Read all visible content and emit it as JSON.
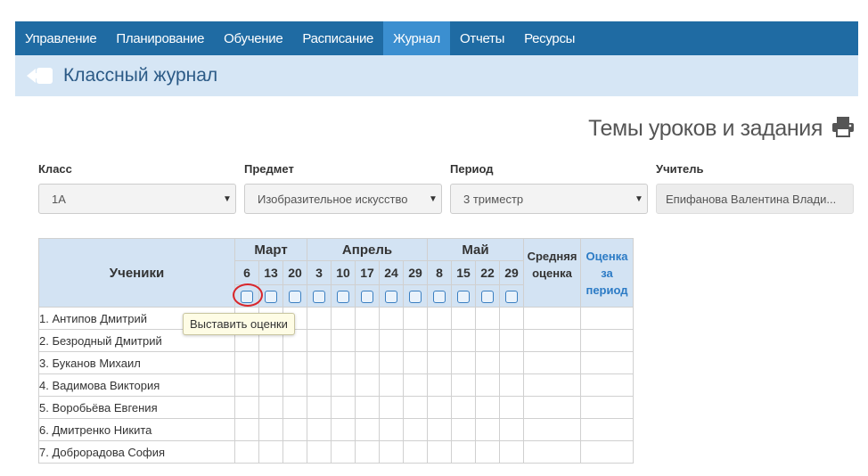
{
  "nav": {
    "items": [
      {
        "label": "Управление"
      },
      {
        "label": "Планирование"
      },
      {
        "label": "Обучение"
      },
      {
        "label": "Расписание"
      },
      {
        "label": "Журнал"
      },
      {
        "label": "Отчеты"
      },
      {
        "label": "Ресурсы"
      }
    ],
    "active_index": 4
  },
  "page": {
    "title": "Классный журнал"
  },
  "lessons_link": {
    "label": "Темы уроков и задания"
  },
  "filters": {
    "class": {
      "label": "Класс",
      "value": "1А"
    },
    "subject": {
      "label": "Предмет",
      "value": "Изобразительное искусство"
    },
    "period": {
      "label": "Период",
      "value": "3 триместр"
    },
    "teacher": {
      "label": "Учитель",
      "value": "Епифанова Валентина Влади..."
    }
  },
  "journal": {
    "students_header": "Ученики",
    "months": [
      {
        "name": "Март",
        "days": [
          "6",
          "13",
          "20"
        ]
      },
      {
        "name": "Апрель",
        "days": [
          "3",
          "10",
          "17",
          "24",
          "29"
        ]
      },
      {
        "name": "Май",
        "days": [
          "8",
          "15",
          "22",
          "29"
        ]
      }
    ],
    "avg_header": [
      "Средняя",
      "оценка"
    ],
    "period_header": [
      "Оценка",
      "за",
      "период"
    ],
    "students": [
      "1. Антипов Дмитрий",
      "2. Безродный Дмитрий",
      "3. Буканов Михаил",
      "4. Вадимова Виктория",
      "5. Воробьёва Евгения",
      "6. Дмитренко Никита",
      "7. Доброрадова София"
    ]
  },
  "tooltip": {
    "text": "Выставить оценки"
  },
  "colors": {
    "nav_bg": "#1f6ba3",
    "nav_active": "#3b8fd0",
    "title_bg": "#d6e6f5",
    "highlight": "#d8262b"
  }
}
